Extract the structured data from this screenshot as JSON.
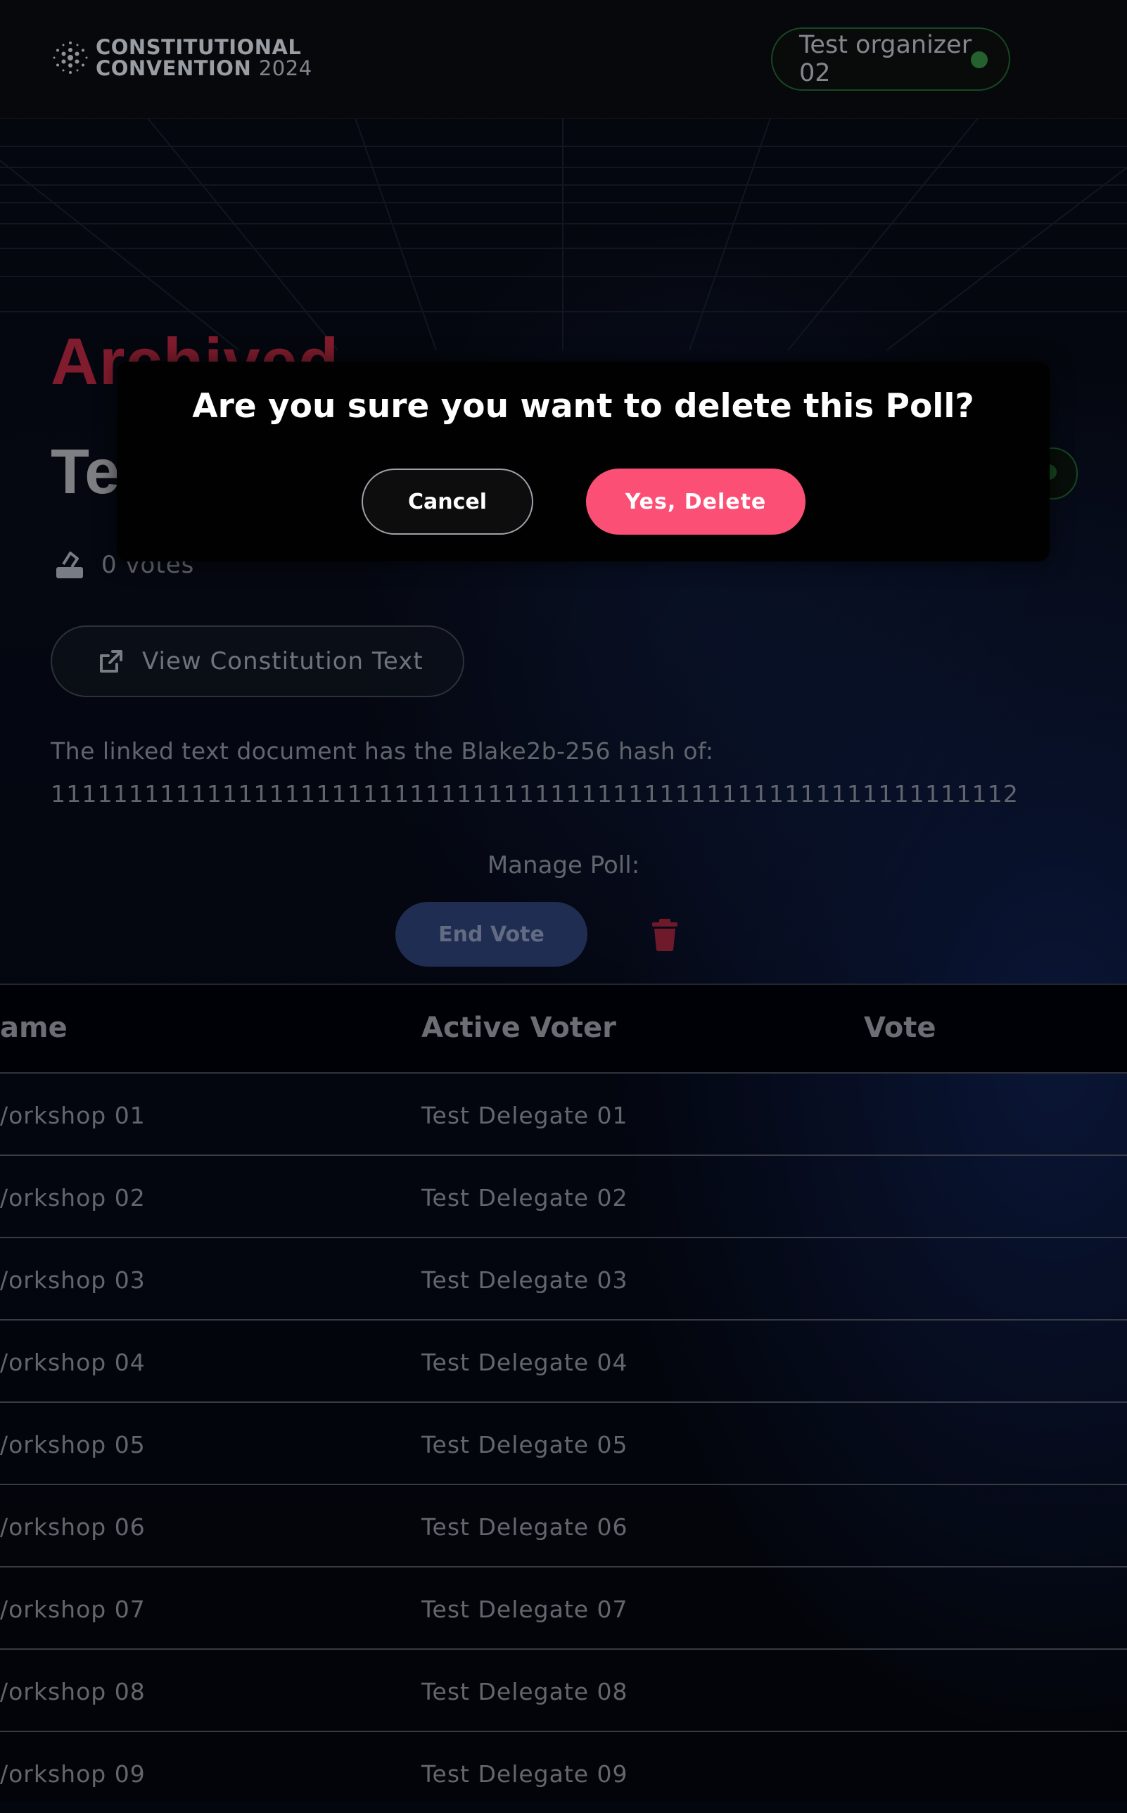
{
  "header": {
    "logo_line1": "CONSTITUTIONAL",
    "logo_line2": "CONVENTION",
    "logo_year": "2024",
    "user_name": "Test organizer 02"
  },
  "poll": {
    "status": "Archived",
    "title": "Te",
    "votes": "0 votes",
    "view_button": "View Constitution Text",
    "hash_label": "The linked text document has the Blake2b-256 hash of:",
    "hash_value": "11111111111111111111111111111111111111111111111111111111111112",
    "manage_label": "Manage Poll:",
    "end_vote": "End Vote"
  },
  "table": {
    "headers": [
      "ame",
      "Active Voter",
      "Vote"
    ],
    "rows": [
      {
        "name": "/orkshop 01",
        "voter": "Test Delegate 01",
        "vote": ""
      },
      {
        "name": "/orkshop 02",
        "voter": "Test Delegate 02",
        "vote": ""
      },
      {
        "name": "/orkshop 03",
        "voter": "Test Delegate 03",
        "vote": ""
      },
      {
        "name": "/orkshop 04",
        "voter": "Test Delegate 04",
        "vote": ""
      },
      {
        "name": "/orkshop 05",
        "voter": "Test Delegate 05",
        "vote": ""
      },
      {
        "name": "/orkshop 06",
        "voter": "Test Delegate 06",
        "vote": ""
      },
      {
        "name": "/orkshop 07",
        "voter": "Test Delegate 07",
        "vote": ""
      },
      {
        "name": "/orkshop 08",
        "voter": "Test Delegate 08",
        "vote": ""
      },
      {
        "name": "/orkshop 09",
        "voter": "Test Delegate 09",
        "vote": ""
      }
    ]
  },
  "modal": {
    "title": "Are you sure you want to delete this Poll?",
    "cancel": "Cancel",
    "confirm": "Yes, Delete"
  },
  "colors": {
    "status_archived": "#a5243a",
    "delete_accent": "#fb4f76",
    "online_dot": "#2f7d3b"
  },
  "icons": {
    "logo": "cardano-logo-icon",
    "user_status": "online-status-dot-icon",
    "votes": "ballot-box-icon",
    "view_link": "external-link-icon",
    "delete": "trash-icon"
  }
}
